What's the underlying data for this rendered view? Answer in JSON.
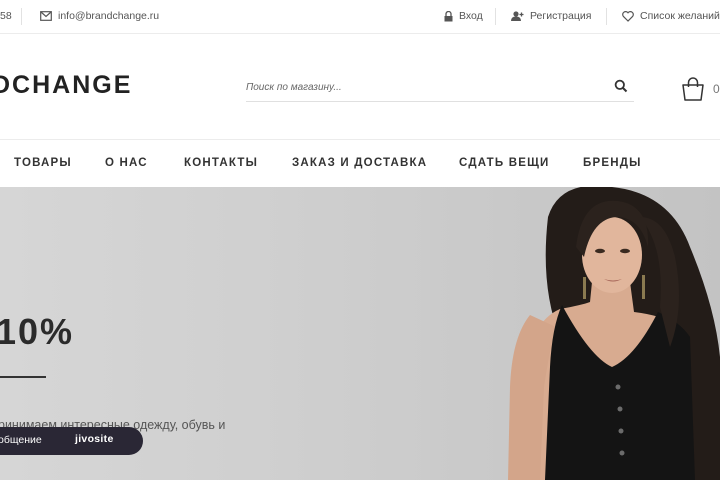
{
  "topbar": {
    "phone_fragment": "58",
    "email": "info@brandchange.ru",
    "login_label": "Вход",
    "register_label": "Регистрация",
    "wishlist_label": "Список желаний"
  },
  "header": {
    "logo_text": "DCHANGE",
    "search_placeholder": "Поиск по магазину...",
    "cart_count": "0"
  },
  "nav": {
    "items": [
      "ТОВАРЫ",
      "О НАС",
      "КОНТАКТЫ",
      "ЗАКАЗ И ДОСТАВКА",
      "СДАТЬ ВЕЩИ",
      "БРЕНДЫ"
    ]
  },
  "hero": {
    "title": "10%",
    "text": "ринимаем интересные одежду, обувь и ксессуары на продажу"
  },
  "chat": {
    "label": "общение",
    "brand": "jivosite"
  },
  "colors": {
    "text_dark": "#222222",
    "hero_bg": "#cfcfcf",
    "chat_bg": "#2a2735"
  }
}
